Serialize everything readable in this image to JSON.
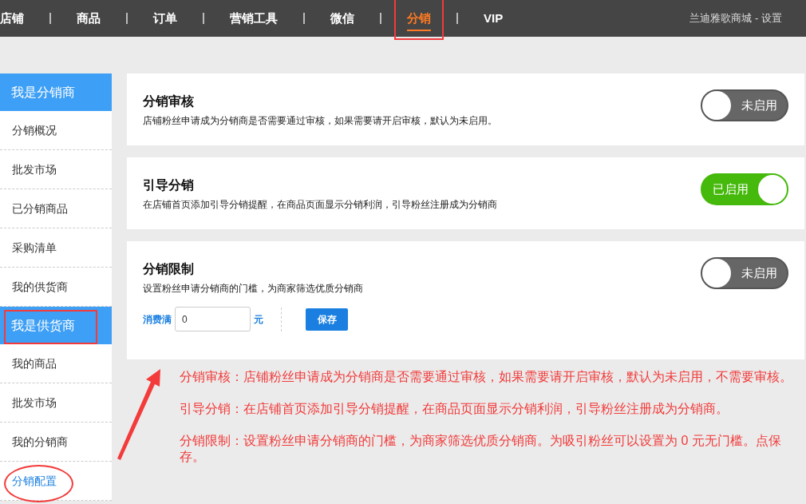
{
  "top_nav": {
    "items": [
      {
        "label": "店铺",
        "selected": false,
        "highlighted": false
      },
      {
        "label": "商品",
        "selected": false,
        "highlighted": false
      },
      {
        "label": "订单",
        "selected": false,
        "highlighted": false
      },
      {
        "label": "营销工具",
        "selected": false,
        "highlighted": false
      },
      {
        "label": "微信",
        "selected": false,
        "highlighted": false
      },
      {
        "label": "分销",
        "selected": true,
        "highlighted": true
      },
      {
        "label": "VIP",
        "selected": false,
        "highlighted": false
      }
    ],
    "account": "兰迪雅歌商城 - 设置"
  },
  "sidebar": {
    "items": [
      {
        "kind": "header",
        "label": "我是分销商",
        "highlighted": false
      },
      {
        "kind": "item",
        "label": "分销概况",
        "selected": false,
        "highlighted": false
      },
      {
        "kind": "item",
        "label": "批发市场",
        "selected": false,
        "highlighted": false
      },
      {
        "kind": "item",
        "label": "已分销商品",
        "selected": false,
        "highlighted": false
      },
      {
        "kind": "item",
        "label": "采购清单",
        "selected": false,
        "highlighted": false
      },
      {
        "kind": "item",
        "label": "我的供货商",
        "selected": false,
        "highlighted": false
      },
      {
        "kind": "header",
        "label": "我是供货商",
        "highlighted": true
      },
      {
        "kind": "item",
        "label": "我的商品",
        "selected": false,
        "highlighted": false
      },
      {
        "kind": "item",
        "label": "批发市场",
        "selected": false,
        "highlighted": false
      },
      {
        "kind": "item",
        "label": "我的分销商",
        "selected": false,
        "highlighted": false
      },
      {
        "kind": "item",
        "label": "分销配置",
        "selected": true,
        "highlighted": true
      }
    ]
  },
  "settings": [
    {
      "title": "分销审核",
      "description": "店铺粉丝申请成为分销商是否需要通过审核，如果需要请开启审核，默认为未启用。",
      "on": false,
      "toggle_label": "未启用"
    },
    {
      "title": "引导分销",
      "description": "在店铺首页添加引导分销提醒，在商品页面显示分销利润，引导粉丝注册成为分销商",
      "on": true,
      "toggle_label": "已启用"
    },
    {
      "title": "分销限制",
      "description": "设置粉丝申请分销商的门槛，为商家筛选优质分销商",
      "on": false,
      "toggle_label": "未启用",
      "threshold": {
        "label": "消费满",
        "value": "0",
        "unit": "元",
        "button": "保存"
      }
    }
  ],
  "notes": [
    "分销审核：店铺粉丝申请成为分销商是否需要通过审核，如果需要请开启审核，默认为未启用，不需要审核。",
    "引导分销：在店铺首页添加引导分销提醒，在商品页面显示分销利润，引导粉丝注册成为分销商。",
    "分销限制：设置粉丝申请分销商的门槛，为商家筛选优质分销商。为吸引粉丝可以设置为 0 元无门槛。点保存。"
  ]
}
